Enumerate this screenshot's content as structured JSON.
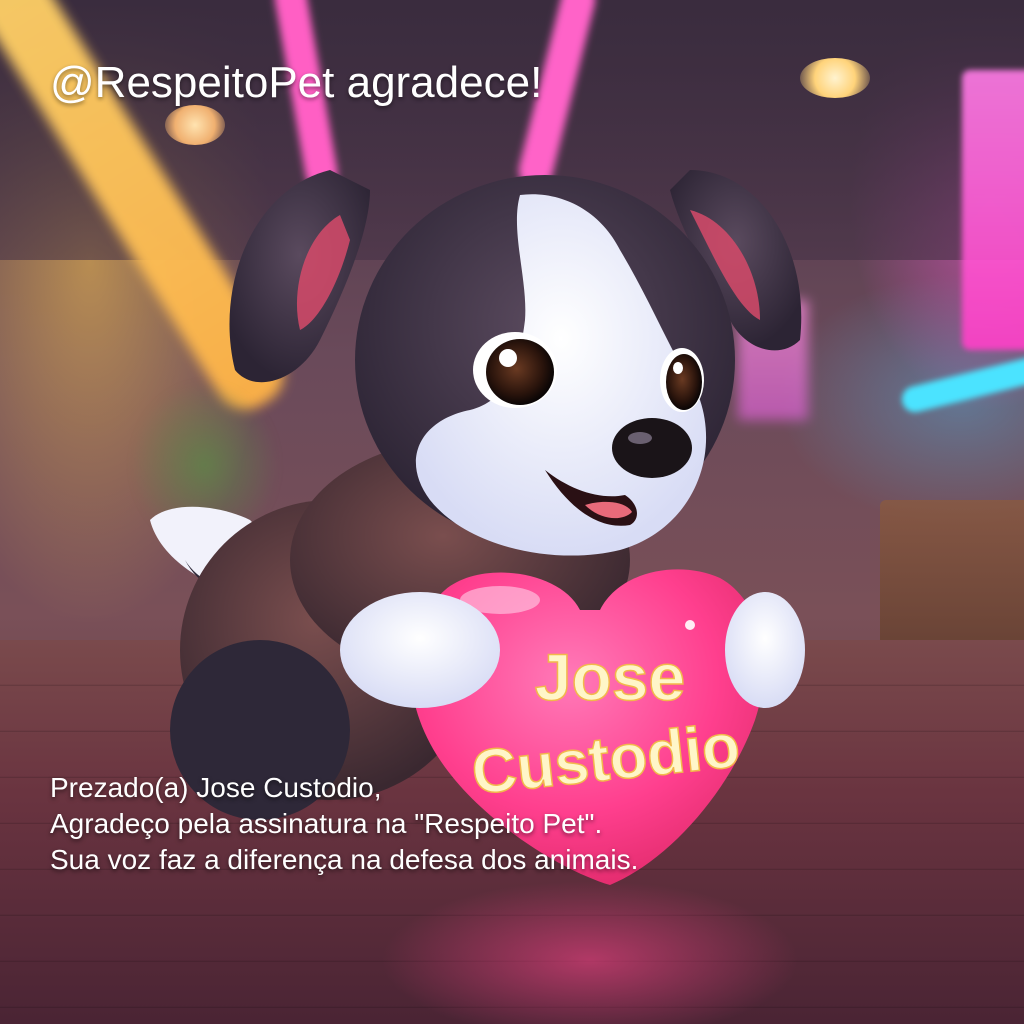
{
  "title": "@RespeitoPet agradece!",
  "heart": {
    "line1": "Jose",
    "line2": "Custodio"
  },
  "message": {
    "line1": "Prezado(a) Jose Custodio,",
    "line2": "Agradeço pela assinatura na \"Respeito Pet\".",
    "line3": "Sua voz faz a diferença na defesa dos animais."
  },
  "colors": {
    "heart": "#ff3f8e",
    "heart_text": "#fff6c8",
    "text": "#ffffff"
  }
}
